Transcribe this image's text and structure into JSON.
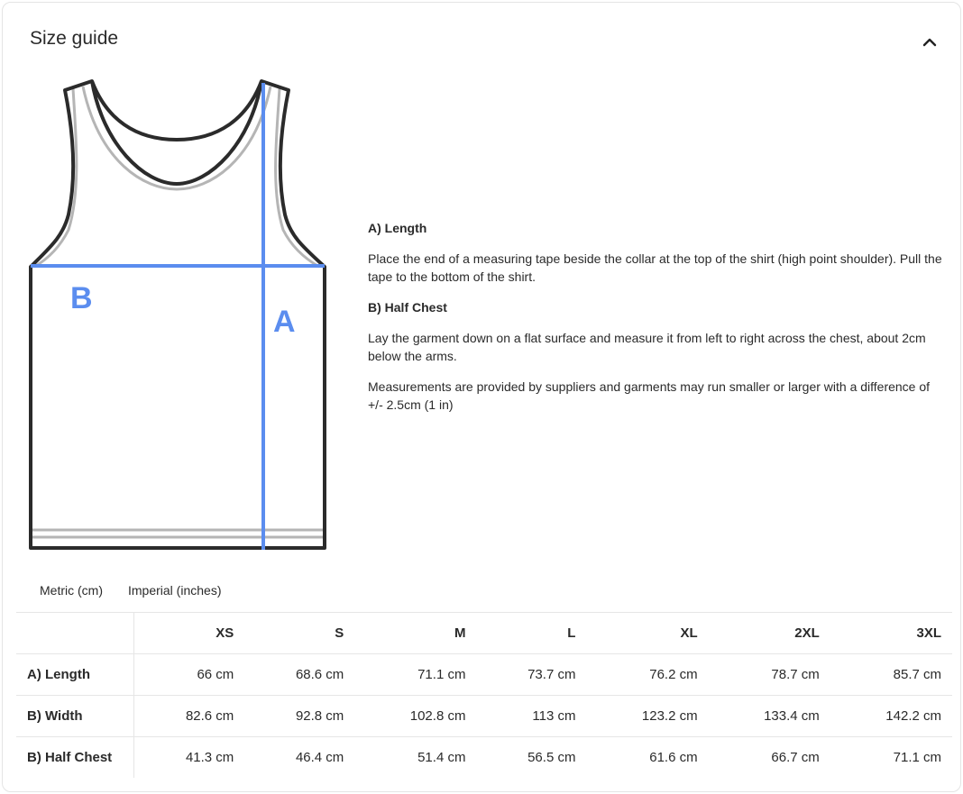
{
  "header": {
    "title": "Size guide",
    "collapse_icon": "chevron-up-icon"
  },
  "illustration": {
    "label_a": "A",
    "label_b": "B",
    "measure_color": "#5b8def",
    "outline_color": "#2b2b2b"
  },
  "description": {
    "length_heading": "A) Length",
    "length_text": "Place the end of a measuring tape beside the collar at the top of the shirt (high point shoulder). Pull the tape to the bottom of the shirt.",
    "chest_heading": "B) Half Chest",
    "chest_text": "Lay the garment down on a flat surface and measure it from left to right across the chest, about 2cm below the arms.",
    "disclaimer": "Measurements are provided by suppliers and garments may run smaller or larger with a difference of +/- 2.5cm (1 in)"
  },
  "units": {
    "metric": "Metric (cm)",
    "imperial": "Imperial (inches)"
  },
  "table": {
    "sizes": [
      "XS",
      "S",
      "M",
      "L",
      "XL",
      "2XL",
      "3XL"
    ],
    "rows": [
      {
        "label": "A) Length",
        "values": [
          "66 cm",
          "68.6 cm",
          "71.1 cm",
          "73.7 cm",
          "76.2 cm",
          "78.7 cm",
          "85.7 cm"
        ]
      },
      {
        "label": "B) Width",
        "values": [
          "82.6 cm",
          "92.8 cm",
          "102.8 cm",
          "113 cm",
          "123.2 cm",
          "133.4 cm",
          "142.2 cm"
        ]
      },
      {
        "label": "B) Half Chest",
        "values": [
          "41.3 cm",
          "46.4 cm",
          "51.4 cm",
          "56.5 cm",
          "61.6 cm",
          "66.7 cm",
          "71.1 cm"
        ]
      }
    ]
  }
}
